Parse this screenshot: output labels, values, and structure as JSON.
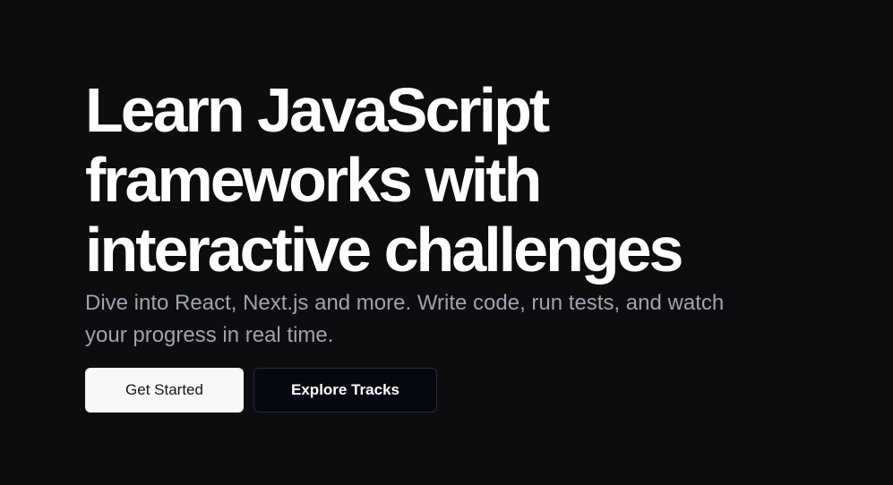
{
  "hero": {
    "headline_lines": [
      "Learn JavaScript",
      "frameworks with",
      "interactive challenges"
    ],
    "subtitle": "Dive into React, Next.js and more. Write code, run tests, and watch your progress in real time."
  },
  "actions": {
    "primary_label": "Get Started",
    "secondary_label": "Explore Tracks"
  },
  "colors": {
    "background": "#0d0c0f",
    "headline": "#ffffff",
    "subtitle": "#9ea3ad",
    "primary_button_bg": "#f7f8fa",
    "secondary_button_bg": "#050810"
  }
}
